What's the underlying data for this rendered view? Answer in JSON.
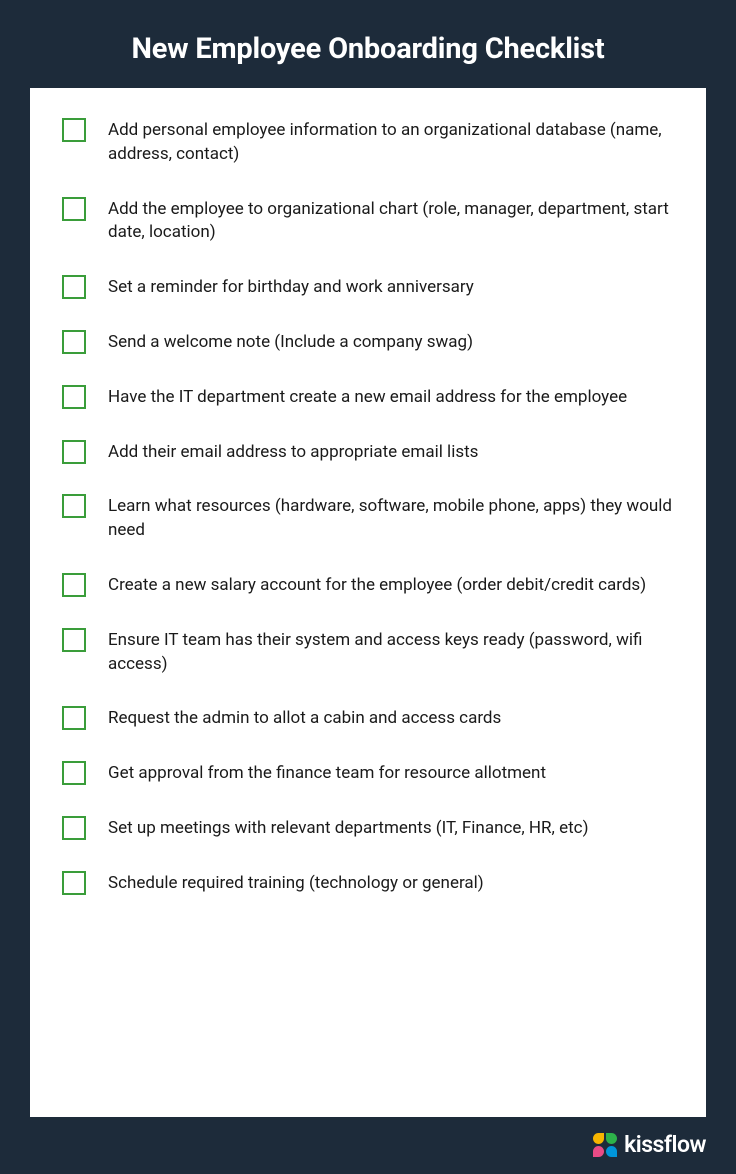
{
  "title": "New Employee Onboarding Checklist",
  "items": [
    "Add personal employee information to an organizational database (name, address, contact)",
    "Add the employee to organizational chart (role, manager, department, start date, location)",
    "Set a reminder for birthday and work anniversary",
    "Send a welcome note (Include a company swag)",
    "Have the IT department create a new email address for the employee",
    "Add their email address to appropriate email lists",
    "Learn what resources (hardware, software, mobile phone, apps) they would need",
    "Create a new salary account for the employee (order debit/credit cards)",
    "Ensure IT team has their system and access keys ready (password, wifi access)",
    "Request the admin to allot a cabin and access cards",
    "Get approval from the finance team for resource allotment",
    "Set up meetings with relevant departments (IT, Finance, HR, etc)",
    "Schedule required training (technology or general)"
  ],
  "brand": "kissflow"
}
